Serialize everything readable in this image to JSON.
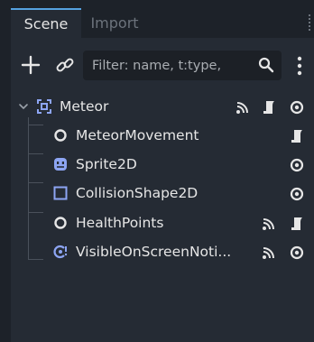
{
  "tabs": [
    {
      "label": "Scene",
      "active": true
    },
    {
      "label": "Import",
      "active": false
    }
  ],
  "toolbar": {
    "filter_placeholder": "Filter: name, t:type,"
  },
  "tree": {
    "root": {
      "name": "Meteor",
      "icon": "node2d-icon",
      "expanded": true,
      "indicators": [
        "signal-icon",
        "script-icon",
        "visibility-icon"
      ]
    },
    "children": [
      {
        "name": "MeteorMovement",
        "icon": "node-icon",
        "indicators": [
          "script-icon"
        ]
      },
      {
        "name": "Sprite2D",
        "icon": "sprite2d-icon",
        "indicators": [
          "visibility-icon"
        ]
      },
      {
        "name": "CollisionShape2D",
        "icon": "collisionshape2d-icon",
        "indicators": [
          "visibility-icon"
        ]
      },
      {
        "name": "HealthPoints",
        "icon": "node-icon",
        "indicators": [
          "signal-icon",
          "script-icon"
        ]
      },
      {
        "name": "VisibleOnScreenNoti...",
        "icon": "visibleonscreennotifier-icon",
        "indicators": [
          "signal-icon",
          "visibility-icon"
        ]
      }
    ]
  },
  "colors": {
    "background": "#1d2229",
    "panel": "#252b34",
    "accent": "#55a2e0",
    "node2d_blue": "#8da5f3",
    "text": "#e6e6e6"
  }
}
